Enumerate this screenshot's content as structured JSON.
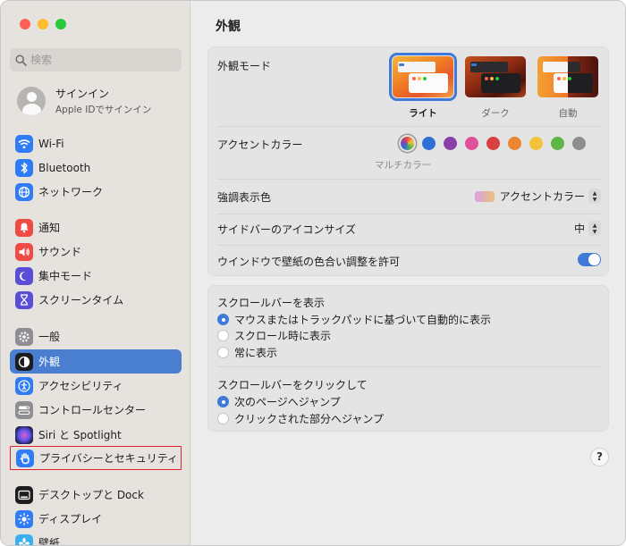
{
  "sidebar": {
    "search_placeholder": "検索",
    "account": {
      "name": "サインイン",
      "subtitle": "Apple IDでサインイン"
    },
    "items": [
      {
        "label": "Wi-Fi",
        "icon": "wifi-icon",
        "color": "#2f7cf6",
        "glyph": "≋"
      },
      {
        "label": "Bluetooth",
        "icon": "bluetooth-icon",
        "color": "#2f7cf6",
        "glyph": "ᛒ"
      },
      {
        "label": "ネットワーク",
        "icon": "network-icon",
        "color": "#2f7cf6",
        "glyph": "◍"
      },
      {
        "label": "通知",
        "icon": "bell-icon",
        "color": "#ef4a43",
        "glyph": "♪"
      },
      {
        "label": "サウンド",
        "icon": "speaker-icon",
        "color": "#ef4a43",
        "glyph": "◀"
      },
      {
        "label": "集中モード",
        "icon": "moon-icon",
        "color": "#5b4ed6",
        "glyph": "☾"
      },
      {
        "label": "スクリーンタイム",
        "icon": "hourglass-icon",
        "color": "#5b4ed6",
        "glyph": "⧗"
      },
      {
        "label": "一般",
        "icon": "gear-icon",
        "color": "#8e8e93",
        "glyph": "⚙"
      },
      {
        "label": "外観",
        "icon": "appearance-icon",
        "color": "#1d1d1f",
        "glyph": "◐"
      },
      {
        "label": "アクセシビリティ",
        "icon": "accessibility-icon",
        "color": "#2f7cf6",
        "glyph": "♿"
      },
      {
        "label": "コントロールセンター",
        "icon": "control-center-icon",
        "color": "#8e8e93",
        "glyph": "≡"
      },
      {
        "label": "Siri と Spotlight",
        "icon": "siri-icon",
        "color": "#3a3a8a",
        "glyph": "●"
      },
      {
        "label": "プライバシーとセキュリティ",
        "icon": "hand-icon",
        "color": "#2f7cf6",
        "glyph": "✋"
      },
      {
        "label": "デスクトップと Dock",
        "icon": "dock-icon",
        "color": "#1d1d1f",
        "glyph": "▭"
      },
      {
        "label": "ディスプレイ",
        "icon": "display-icon",
        "color": "#2f7cf6",
        "glyph": "☀"
      },
      {
        "label": "壁紙",
        "icon": "wallpaper-icon",
        "color": "#3ab0f0",
        "glyph": "❋"
      }
    ]
  },
  "main": {
    "title": "外観",
    "appearance": {
      "label": "外観モード",
      "options": [
        "ライト",
        "ダーク",
        "自動"
      ]
    },
    "accent": {
      "label": "アクセントカラー",
      "caption": "マルチカラー",
      "colors": [
        "#2f6fd6",
        "#8a3fa8",
        "#e0509a",
        "#d94040",
        "#e9862f",
        "#f3c23a",
        "#5fb545",
        "#8e8e8e"
      ]
    },
    "highlight": {
      "label": "強調表示色",
      "value": "アクセントカラー"
    },
    "icon_size": {
      "label": "サイドバーのアイコンサイズ",
      "value": "中"
    },
    "tinting": {
      "label": "ウインドウで壁紙の色合い調整を許可",
      "enabled": true
    },
    "scrollbars": {
      "show_label": "スクロールバーを表示",
      "show_options": [
        "マウスまたはトラックパッドに基づいて自動的に表示",
        "スクロール時に表示",
        "常に表示"
      ],
      "click_label": "スクロールバーをクリックして",
      "click_options": [
        "次のページへジャンプ",
        "クリックされた部分へジャンプ"
      ]
    },
    "help": "?"
  }
}
